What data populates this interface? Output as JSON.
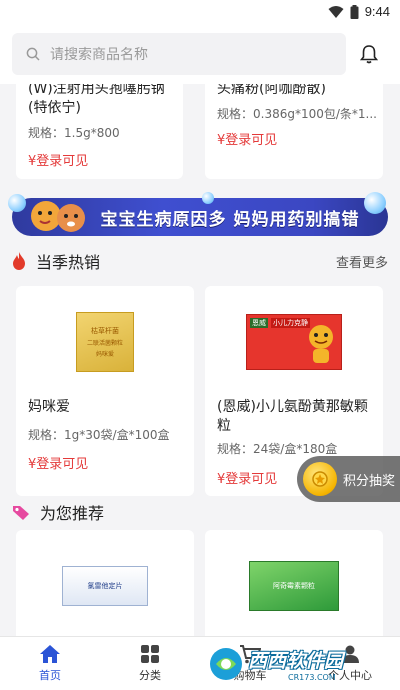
{
  "status_bar": {
    "time": "9:44",
    "icons": [
      "wifi-icon",
      "battery-icon"
    ]
  },
  "search": {
    "placeholder": "请搜索商品名称"
  },
  "top_products": [
    {
      "name": "(W)注射用头孢噻肟钠(特依宁)",
      "spec": "规格：1.5g*800",
      "price": "¥登录可见"
    },
    {
      "name": "头痛粉(阿咖酚散)",
      "spec": "规格：0.386g*100包/条*1...",
      "price": "¥登录可见"
    }
  ],
  "banner": {
    "text": "宝宝生病原因多 妈妈用药别搞错"
  },
  "hot_section": {
    "title": "当季热销",
    "more": "查看更多"
  },
  "hot_products": [
    {
      "name": "妈咪爱",
      "spec": "规格：1g*30袋/盒*100盒",
      "price": "¥登录可见",
      "box_label_1": "枯草杆菌",
      "box_label_2": "二联活菌颗粒",
      "box_label_3": "妈咪爱"
    },
    {
      "name": "(恩威)小儿氨酚黄那敏颗粒",
      "spec": "规格：24袋/盒*180盒",
      "price": "¥登录可见",
      "box_label_1": "恩威",
      "box_label_2": "小儿力克静"
    }
  ],
  "recommend_section": {
    "title": "为您推荐"
  },
  "recommend_products": [
    {
      "box_label": "氯雷他定片"
    },
    {
      "box_label": "阿奇霉素颗粒"
    }
  ],
  "float_button": {
    "label": "积分抽奖"
  },
  "tabs": [
    {
      "label": "首页",
      "icon": "home-icon",
      "active": true
    },
    {
      "label": "分类",
      "icon": "grid-icon",
      "active": false
    },
    {
      "label": "购物车",
      "icon": "cart-icon",
      "active": false
    },
    {
      "label": "个人中心",
      "icon": "user-icon",
      "active": false
    }
  ],
  "watermark": {
    "text": "西西软件园",
    "sub": "CR173.COM"
  },
  "colors": {
    "accent": "#2b54d6",
    "price": "#e43a3a",
    "banner": "#3f4fd0"
  }
}
